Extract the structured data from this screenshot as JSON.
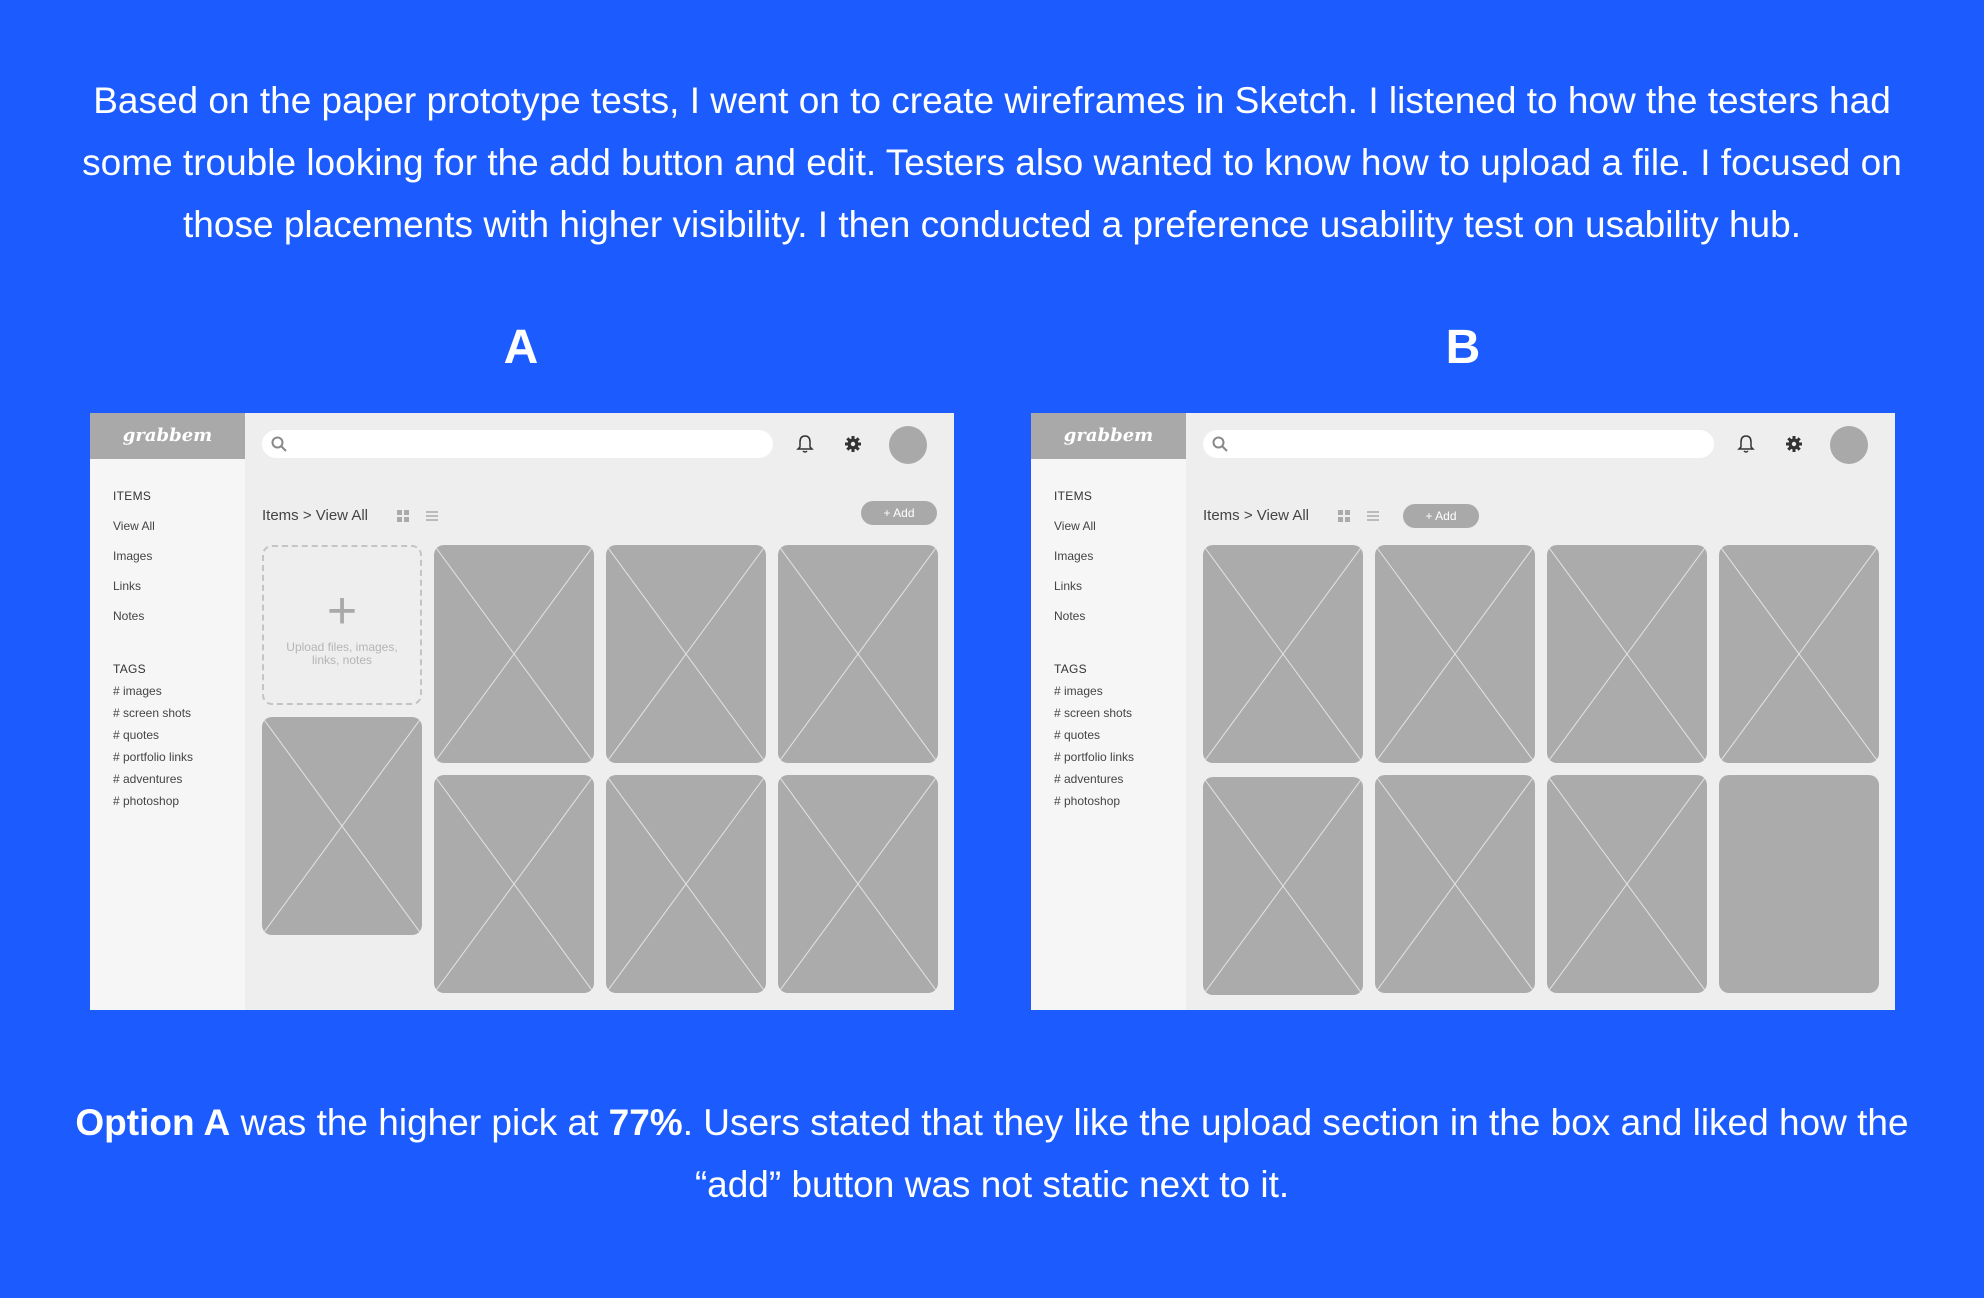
{
  "intro": {
    "text": "Based on the paper prototype tests, I went on to create wireframes in Sketch. I listened to how the testers had some trouble looking for the add button and edit. Testers also wanted to know how to upload a file. I focused on those placements with higher visibility. I then conducted a preference usability test on usability hub."
  },
  "variants": [
    {
      "label": "A",
      "logo": "grabbem",
      "items_heading": "ITEMS",
      "nav_items": [
        "View All",
        "Images",
        "Links",
        "Notes"
      ],
      "tags_heading": "TAGS",
      "tags": [
        "# images",
        "# screen shots",
        "# quotes",
        "# portfolio links",
        "# adventures",
        "# photoshop"
      ],
      "breadcrumb": "Items > View All",
      "add_label": "+ Add",
      "upload_plus": "+",
      "upload_text": "Upload files, images, links, notes"
    },
    {
      "label": "B",
      "logo": "grabbem",
      "items_heading": "ITEMS",
      "nav_items": [
        "View All",
        "Images",
        "Links",
        "Notes"
      ],
      "tags_heading": "TAGS",
      "tags": [
        "# images",
        "# screen shots",
        "# quotes",
        "# portfolio links",
        "# adventures",
        "# photoshop"
      ],
      "breadcrumb": "Items > View All",
      "add_label": "+ Add"
    }
  ],
  "summary": {
    "option_label": "Option A",
    "text_1": " was the higher pick at ",
    "percent": "77%",
    "text_2": ". Users stated that they like the upload section in the box and liked how the “add” button was not static next to it."
  },
  "colors": {
    "background": "#1c5cff",
    "wire_bg": "#eeeeee",
    "sidebar_bg": "#f6f6f6",
    "placeholder": "#ababab"
  },
  "icons": [
    "search-icon",
    "bell-icon",
    "gear-icon",
    "avatar",
    "grid-view-icon",
    "list-view-icon",
    "image-placeholder-icon"
  ]
}
